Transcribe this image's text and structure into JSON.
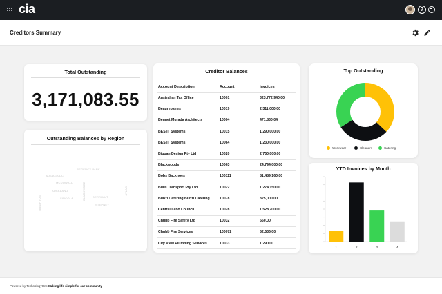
{
  "app": {
    "logo": "cia"
  },
  "header": {
    "title": "Creditors Summary"
  },
  "total_outstanding": {
    "title": "Total Outstanding",
    "value": "3,171,083.55"
  },
  "region": {
    "title": "Outstanding Balances by Region",
    "words": [
      "REGENCY PARK",
      "MALAGA DC",
      "BLACKWOOD",
      "MCDOWALL",
      "AUCKLAND",
      "SINCOLA",
      "BRIGHTON",
      "DERRIMUT",
      "STEPNEY",
      "ATLAS"
    ]
  },
  "balances": {
    "title": "Creditor Balances",
    "columns": [
      "Account Description",
      "Account",
      "Invoices"
    ],
    "rows": [
      [
        "Australian Tax Office",
        "10001",
        "323,772,940.00"
      ],
      [
        "Beaurepaires",
        "10019",
        "2,311,000.00"
      ],
      [
        "Bennet Murada Architects",
        "10004",
        "471,830.04"
      ],
      [
        "BES IT Systems",
        "10015",
        "1,290,000.00"
      ],
      [
        "BES IT Systems",
        "10064",
        "1,230,000.00"
      ],
      [
        "Biggan Design Pty Ltd",
        "10020",
        "2,750,000.00"
      ],
      [
        "Blackwoods",
        "10063",
        "24,794,000.00"
      ],
      [
        "Bobs Backhoes",
        "100111",
        "81,489,160.00"
      ],
      [
        "Bulls Transport Pty Ltd",
        "10022",
        "1,274,150.00"
      ],
      [
        "Bunzl Catering Bunzl Catering",
        "10078",
        "325,000.00"
      ],
      [
        "Central Land Council",
        "10028",
        "1,528,700.00"
      ],
      [
        "Chubb Fire Safety Ltd",
        "10032",
        "560.00"
      ],
      [
        "Chubb Fire Services",
        "100072",
        "52,536.00"
      ],
      [
        "City View Plumbing Services",
        "10033",
        "1,290.00"
      ]
    ]
  },
  "top_outstanding": {
    "title": "Top Outstanding",
    "legend": [
      "Workwear",
      "Cleaners",
      "Catering"
    ],
    "colors": [
      "#ffc107",
      "#0d0f12",
      "#39d353"
    ]
  },
  "ytd": {
    "title": "YTD Invoices by Month",
    "colors": [
      "#ffc107",
      "#0d0f12",
      "#39d353",
      "#dcdcdc"
    ]
  },
  "footer": {
    "powered": "Powered by TechnologyOne",
    "tagline": "Making life simple for our community"
  },
  "chart_data": [
    {
      "type": "pie",
      "title": "Top Outstanding",
      "categories": [
        "Workwear",
        "Cleaners",
        "Catering"
      ],
      "values": [
        37,
        29,
        34
      ]
    },
    {
      "type": "bar",
      "title": "YTD Invoices by Month",
      "categories": [
        "1",
        "2",
        "3",
        "4"
      ],
      "values": [
        15,
        82,
        43,
        28
      ],
      "ylim": [
        0,
        90
      ],
      "grid": false
    }
  ]
}
